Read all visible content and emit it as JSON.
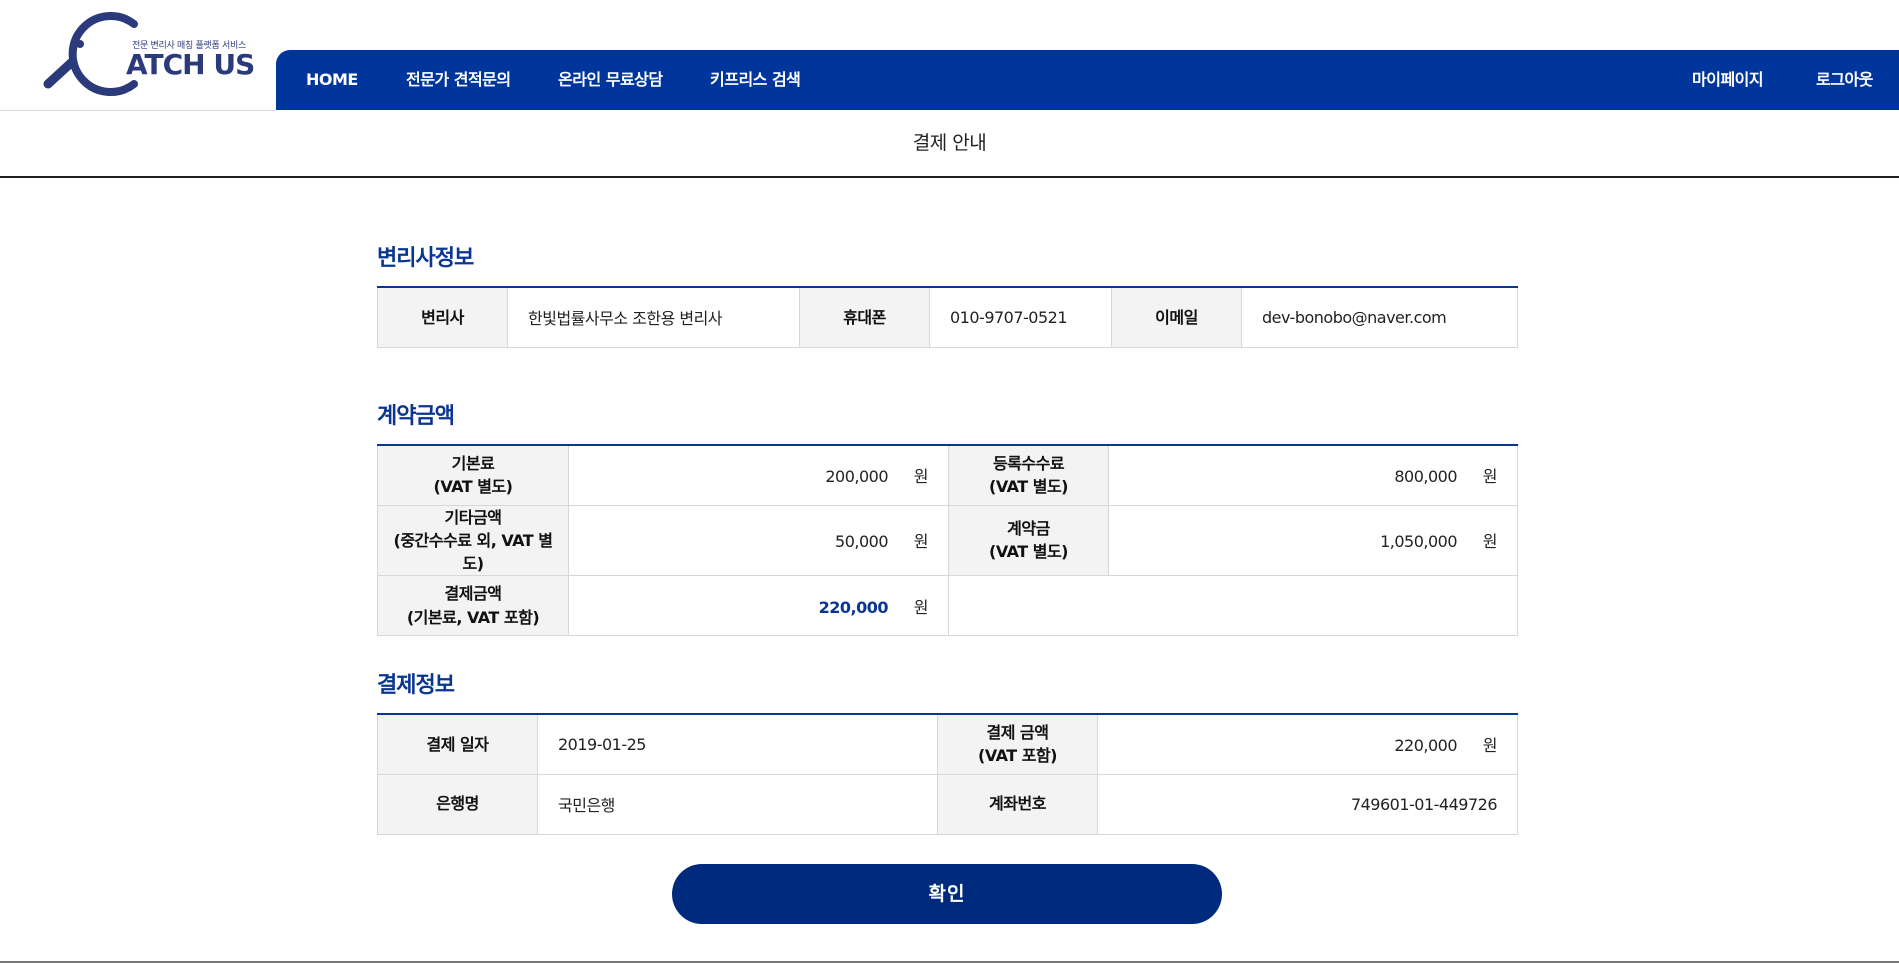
{
  "logo": {
    "tagline": "전문 변리사 매칭 플랫폼 서비스",
    "text": "ATCH US"
  },
  "nav": {
    "left": [
      "HOME",
      "전문가 견적문의",
      "온라인 무료상담",
      "키프리스 검색"
    ],
    "right": [
      "마이페이지",
      "로그아웃"
    ]
  },
  "page": {
    "title": "결제 안내"
  },
  "attorney": {
    "section_title": "변리사정보",
    "name_label": "변리사",
    "name": "한빛법률사무소 조한용 변리사",
    "phone_label": "휴대폰",
    "phone": "010-9707-0521",
    "email_label": "이메일",
    "email": "dev-bonobo@naver.com"
  },
  "contract": {
    "section_title": "계약금액",
    "unit": "원",
    "base_label_1": "기본료",
    "base_label_2": "(VAT 별도)",
    "base_value": "200,000",
    "reg_label_1": "등록수수료",
    "reg_label_2": "(VAT 별도)",
    "reg_value": "800,000",
    "etc_label_1": "기타금액",
    "etc_label_2": "(중간수수료 외, VAT 별도)",
    "etc_value": "50,000",
    "deposit_label_1": "계약금",
    "deposit_label_2": "(VAT 별도)",
    "deposit_value": "1,050,000",
    "pay_label_1": "결제금액",
    "pay_label_2": "(기본료, VAT 포함)",
    "pay_value": "220,000"
  },
  "payment": {
    "section_title": "결제정보",
    "unit": "원",
    "date_label": "결제 일자",
    "date": "2019-01-25",
    "amount_label_1": "결제 금액",
    "amount_label_2": "(VAT 포함)",
    "amount": "220,000",
    "bank_label": "은행명",
    "bank": "국민은행",
    "account_label": "계좌번호",
    "account": "749601-01-449726"
  },
  "confirm_label": "확인"
}
